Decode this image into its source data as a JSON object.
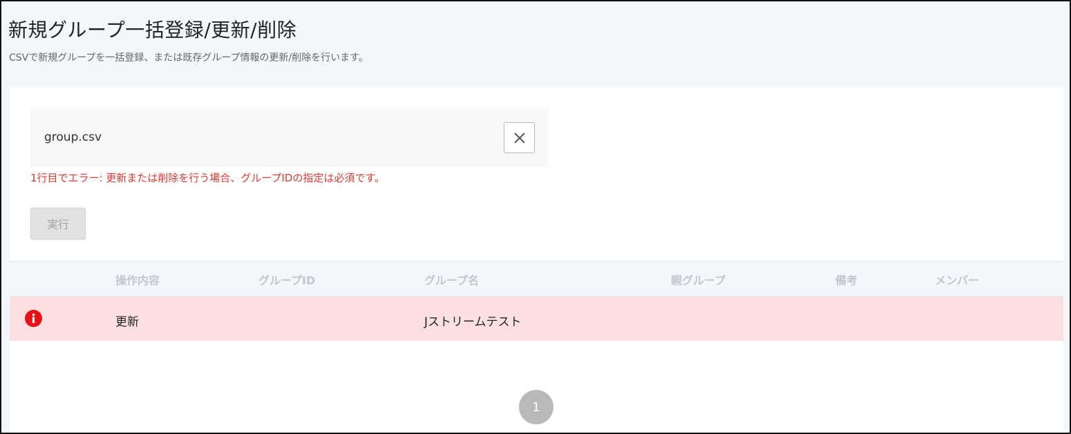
{
  "header": {
    "title": "新規グループ一括登録/更新/削除",
    "subtitle": "CSVで新規グループを一括登録、または既存グループ情報の更新/削除を行います。"
  },
  "upload": {
    "file_name": "group.csv",
    "clear_icon": "close-icon"
  },
  "error": {
    "message": "1行目でエラー: 更新または削除を行う場合、グループIDの指定は必須です。",
    "color": "#e03a32"
  },
  "actions": {
    "run_label": "実行"
  },
  "table": {
    "columns": [
      "操作内容",
      "グループID",
      "グループ名",
      "親グループ",
      "備考",
      "メンバー"
    ],
    "rows": [
      {
        "status_icon": "error-info-icon",
        "operation": "更新",
        "group_id": "",
        "group_name": "Jストリームテスト",
        "parent_group": "",
        "note": "",
        "members": ""
      }
    ],
    "row_error_bg": "#fce0e1"
  },
  "pagination": {
    "current_page": "1"
  }
}
